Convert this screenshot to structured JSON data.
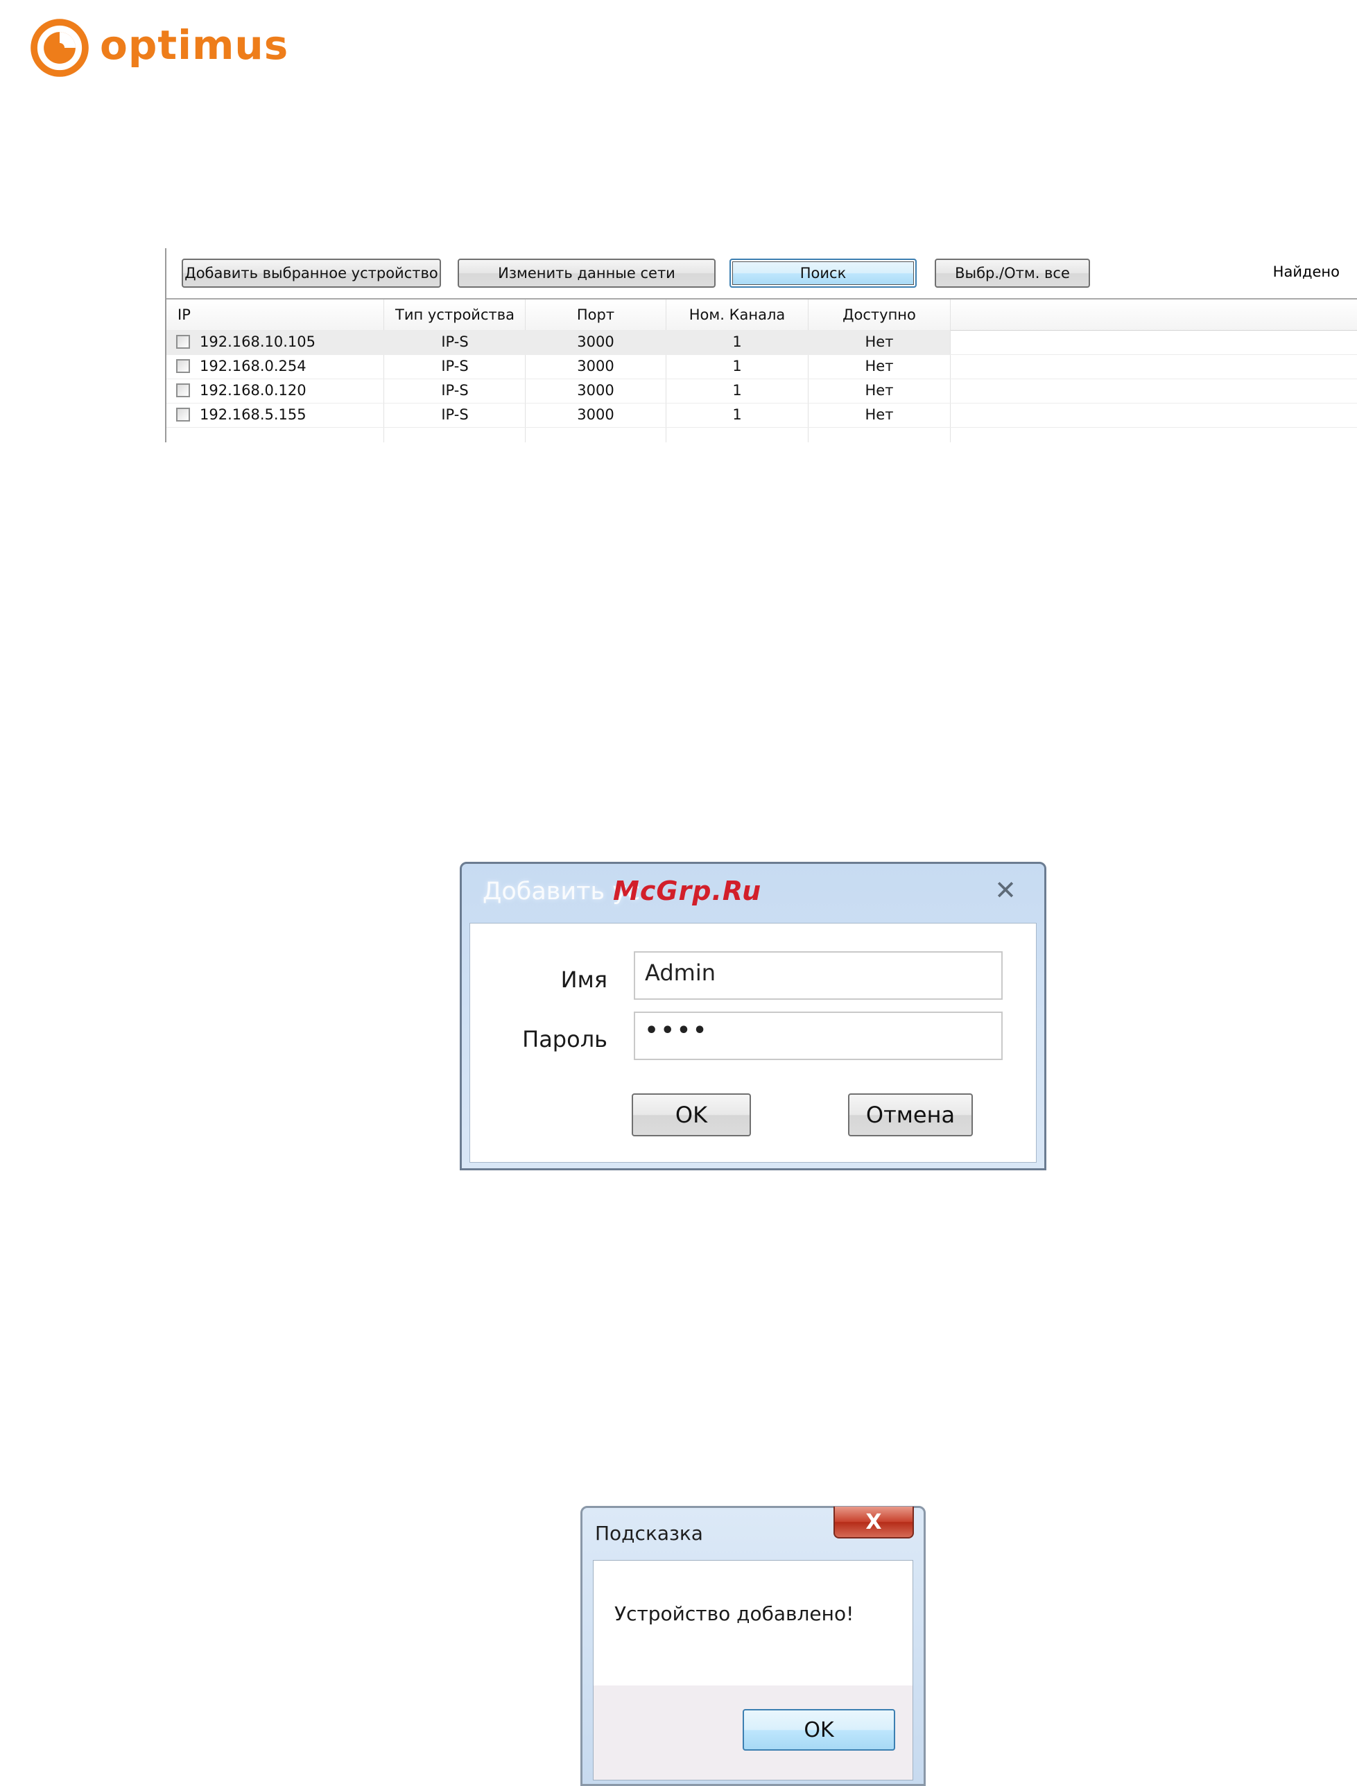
{
  "logo": {
    "text": "optimus",
    "color": "#ee7d1a"
  },
  "search_panel": {
    "toolbar": {
      "add_selected": "Добавить выбранное устройство",
      "change_network": "Изменить данные сети",
      "search": "Поиск",
      "select_all": "Выбр./Отм. все",
      "found_label": "Найдено"
    },
    "columns": {
      "ip": "IP",
      "device_type": "Тип устройства",
      "port": "Порт",
      "channel": "Ном. Канала",
      "available": "Доступно"
    },
    "rows": [
      {
        "ip": "192.168.10.105",
        "type": "IP-S",
        "port": "3000",
        "channel": "1",
        "available": "Нет",
        "checked": false,
        "selected": true
      },
      {
        "ip": "192.168.0.254",
        "type": "IP-S",
        "port": "3000",
        "channel": "1",
        "available": "Нет",
        "checked": false,
        "selected": false
      },
      {
        "ip": "192.168.0.120",
        "type": "IP-S",
        "port": "3000",
        "channel": "1",
        "available": "Нет",
        "checked": false,
        "selected": false
      },
      {
        "ip": "192.168.5.155",
        "type": "IP-S",
        "port": "3000",
        "channel": "1",
        "available": "Нет",
        "checked": false,
        "selected": false
      }
    ]
  },
  "add_dialog": {
    "title": "Добавить ус",
    "close": "✕",
    "name_label": "Имя",
    "name_value": "Admin",
    "password_label": "Пароль",
    "password_value": "••••",
    "ok": "OK",
    "cancel": "Отмена"
  },
  "watermark": "McGrp.Ru",
  "hint_dialog": {
    "title": "Подсказка",
    "close": "X",
    "message": "Устройство добавлено!",
    "ok": "OK"
  }
}
